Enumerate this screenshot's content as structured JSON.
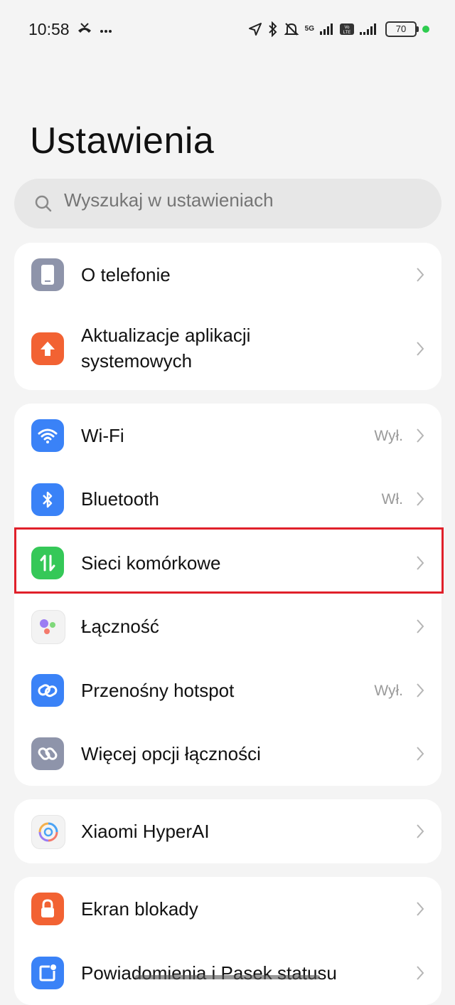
{
  "status_bar": {
    "time": "10:58",
    "left_icons": [
      "missed-call-icon",
      "more-dots-icon"
    ],
    "network_label": "5G",
    "volte_label": "Vo LTE",
    "battery": "70"
  },
  "page": {
    "title": "Ustawienia"
  },
  "search": {
    "placeholder": "Wyszukaj w ustawieniach"
  },
  "groups": [
    {
      "items": [
        {
          "label": "O telefonie",
          "icon": "phone-icon",
          "color": "#8e94aa"
        },
        {
          "label_line1": "Aktualizacje aplikacji",
          "label_line2": "systemowych",
          "icon": "arrow-up-icon",
          "color": "#f26233"
        }
      ]
    },
    {
      "items": [
        {
          "label": "Wi-Fi",
          "value": "Wył.",
          "icon": "wifi-icon",
          "color": "#3a82f7"
        },
        {
          "label": "Bluetooth",
          "value": "Wł.",
          "icon": "bluetooth-icon",
          "color": "#3a82f7"
        },
        {
          "label": "Sieci komórkowe",
          "icon": "mobile-data-icon",
          "color": "#35c858",
          "highlighted": true
        },
        {
          "label": "Łączność",
          "icon": "connectivity-dots-icon",
          "color": "#f3f3f3"
        },
        {
          "label": "Przenośny hotspot",
          "value": "Wył.",
          "icon": "hotspot-icon",
          "color": "#3a82f7"
        },
        {
          "label": "Więcej opcji łączności",
          "icon": "link-icon",
          "color": "#8e94aa"
        }
      ]
    },
    {
      "items": [
        {
          "label": "Xiaomi HyperAI",
          "icon": "hyperai-icon",
          "color": "#f3f3f3"
        }
      ]
    },
    {
      "items": [
        {
          "label": "Ekran blokady",
          "icon": "lock-icon",
          "color": "#f26233"
        },
        {
          "label": "Powiadomienia i Pasek statusu",
          "icon": "notification-icon",
          "color": "#3a82f7"
        }
      ]
    }
  ],
  "highlight_color": "#e0202a"
}
